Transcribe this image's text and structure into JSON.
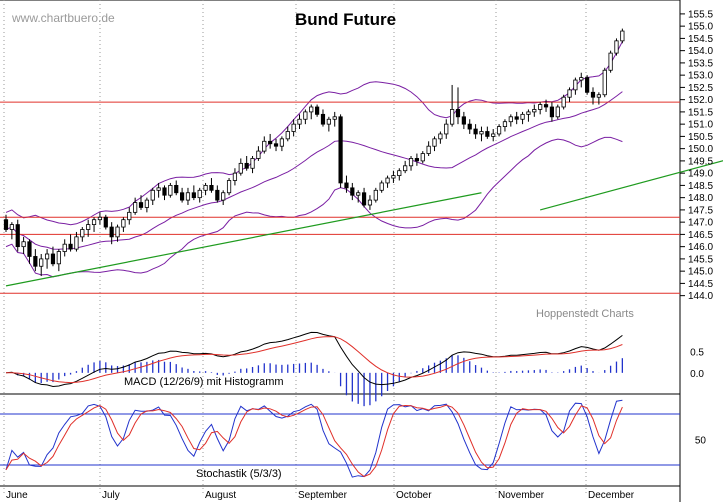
{
  "watermark": "www.chartbuero.de",
  "source_label": "Hoppenstedt Charts",
  "chart_data": [
    {
      "type": "candlestick",
      "title": "Bund Future",
      "y_ticks": [
        155.5,
        155.0,
        154.5,
        154.0,
        153.5,
        153.0,
        152.5,
        152.0,
        151.5,
        151.0,
        150.5,
        150.0,
        149.5,
        149.0,
        148.5,
        148.0,
        147.5,
        147.0,
        146.5,
        146.0,
        145.5,
        145.0,
        144.5,
        144.0
      ],
      "ylim": [
        143.7,
        155.7
      ],
      "x_labels": [
        "June",
        "July",
        "August",
        "September",
        "October",
        "November",
        "December"
      ],
      "horizontal_levels": [
        151.9,
        147.2,
        146.5,
        144.1
      ],
      "trendlines": [
        {
          "from": [
            0,
            144.4
          ],
          "to": [
            81,
            148.2
          ]
        },
        {
          "from": [
            91,
            147.5
          ],
          "to": [
            167,
            152.4
          ]
        }
      ],
      "candles": [
        [
          147.1,
          147.3,
          146.6,
          146.7
        ],
        [
          146.7,
          147.0,
          146.3,
          146.9
        ],
        [
          146.9,
          147.1,
          145.8,
          146.0
        ],
        [
          146.0,
          146.4,
          145.7,
          146.2
        ],
        [
          146.2,
          146.3,
          145.3,
          145.6
        ],
        [
          145.6,
          145.9,
          145.0,
          145.2
        ],
        [
          145.2,
          145.7,
          144.8,
          145.5
        ],
        [
          145.5,
          145.9,
          145.1,
          145.7
        ],
        [
          145.7,
          146.0,
          145.2,
          145.3
        ],
        [
          145.3,
          145.9,
          145.0,
          145.8
        ],
        [
          145.8,
          146.3,
          145.6,
          146.1
        ],
        [
          146.1,
          146.5,
          145.8,
          145.9
        ],
        [
          145.9,
          146.6,
          145.8,
          146.4
        ],
        [
          146.4,
          146.8,
          146.2,
          146.7
        ],
        [
          146.7,
          147.1,
          146.4,
          146.9
        ],
        [
          146.9,
          147.2,
          146.6,
          147.1
        ],
        [
          147.1,
          147.4,
          146.9,
          147.2
        ],
        [
          147.2,
          147.3,
          146.7,
          146.8
        ],
        [
          146.8,
          147.0,
          146.1,
          146.4
        ],
        [
          146.4,
          146.9,
          146.2,
          146.8
        ],
        [
          146.8,
          147.2,
          146.6,
          147.1
        ],
        [
          147.1,
          147.6,
          146.9,
          147.4
        ],
        [
          147.4,
          148.0,
          147.3,
          147.8
        ],
        [
          147.8,
          148.1,
          147.5,
          147.6
        ],
        [
          147.6,
          148.0,
          147.4,
          147.9
        ],
        [
          147.9,
          148.4,
          147.7,
          148.3
        ],
        [
          148.3,
          148.6,
          148.0,
          148.4
        ],
        [
          148.4,
          148.5,
          147.9,
          148.1
        ],
        [
          148.1,
          148.6,
          148.0,
          148.5
        ],
        [
          148.5,
          148.7,
          148.1,
          148.2
        ],
        [
          148.2,
          148.4,
          147.8,
          147.9
        ],
        [
          147.9,
          148.4,
          147.7,
          148.2
        ],
        [
          148.2,
          148.5,
          147.9,
          148.0
        ],
        [
          148.0,
          148.4,
          147.8,
          148.3
        ],
        [
          148.3,
          148.6,
          148.1,
          148.5
        ],
        [
          148.5,
          148.8,
          148.2,
          148.3
        ],
        [
          148.3,
          148.5,
          147.8,
          147.9
        ],
        [
          147.9,
          148.3,
          147.7,
          148.2
        ],
        [
          148.2,
          148.8,
          148.1,
          148.7
        ],
        [
          148.7,
          149.2,
          148.5,
          149.0
        ],
        [
          149.0,
          149.6,
          148.9,
          149.4
        ],
        [
          149.4,
          149.7,
          149.1,
          149.2
        ],
        [
          149.2,
          149.7,
          149.0,
          149.6
        ],
        [
          149.6,
          150.1,
          149.5,
          149.9
        ],
        [
          149.9,
          150.5,
          149.8,
          150.3
        ],
        [
          150.3,
          150.6,
          150.0,
          150.2
        ],
        [
          150.2,
          150.4,
          149.9,
          150.1
        ],
        [
          150.1,
          150.5,
          149.9,
          150.4
        ],
        [
          150.4,
          150.9,
          150.3,
          150.7
        ],
        [
          150.7,
          151.2,
          150.5,
          151.0
        ],
        [
          151.0,
          151.4,
          150.8,
          151.2
        ],
        [
          151.2,
          151.6,
          151.0,
          151.5
        ],
        [
          151.5,
          151.8,
          151.2,
          151.7
        ],
        [
          151.7,
          151.8,
          151.3,
          151.4
        ],
        [
          151.4,
          151.6,
          150.9,
          151.0
        ],
        [
          151.0,
          151.3,
          150.7,
          151.2
        ],
        [
          151.2,
          151.5,
          150.9,
          151.3
        ],
        [
          151.3,
          151.4,
          148.4,
          148.6
        ],
        [
          148.6,
          148.9,
          148.2,
          148.4
        ],
        [
          148.4,
          148.6,
          147.9,
          148.1
        ],
        [
          148.1,
          148.3,
          147.8,
          148.2
        ],
        [
          148.2,
          148.4,
          147.6,
          147.7
        ],
        [
          147.7,
          148.1,
          147.5,
          147.9
        ],
        [
          147.9,
          148.4,
          147.8,
          148.3
        ],
        [
          148.3,
          148.7,
          148.2,
          148.6
        ],
        [
          148.6,
          148.9,
          148.4,
          148.8
        ],
        [
          148.8,
          149.1,
          148.6,
          148.9
        ],
        [
          148.9,
          149.2,
          148.7,
          149.1
        ],
        [
          149.1,
          149.5,
          149.0,
          149.3
        ],
        [
          149.3,
          149.7,
          149.1,
          149.6
        ],
        [
          149.6,
          149.8,
          149.3,
          149.5
        ],
        [
          149.5,
          149.9,
          149.4,
          149.8
        ],
        [
          149.8,
          150.3,
          149.7,
          150.1
        ],
        [
          150.1,
          150.5,
          149.9,
          150.4
        ],
        [
          150.4,
          150.7,
          150.2,
          150.6
        ],
        [
          150.6,
          151.2,
          150.4,
          151.0
        ],
        [
          151.0,
          152.6,
          150.9,
          151.6
        ],
        [
          151.6,
          152.5,
          151.0,
          151.3
        ],
        [
          151.3,
          151.5,
          150.8,
          151.0
        ],
        [
          151.0,
          151.2,
          150.6,
          150.8
        ],
        [
          150.8,
          151.0,
          150.4,
          150.6
        ],
        [
          150.6,
          150.9,
          150.3,
          150.7
        ],
        [
          150.7,
          150.9,
          150.4,
          150.5
        ],
        [
          150.5,
          150.8,
          150.3,
          150.6
        ],
        [
          150.6,
          151.0,
          150.5,
          150.9
        ],
        [
          150.9,
          151.2,
          150.7,
          151.1
        ],
        [
          151.1,
          151.4,
          150.9,
          151.3
        ],
        [
          151.3,
          151.5,
          151.0,
          151.2
        ],
        [
          151.2,
          151.5,
          151.0,
          151.4
        ],
        [
          151.4,
          151.6,
          151.1,
          151.5
        ],
        [
          151.5,
          151.8,
          151.3,
          151.6
        ],
        [
          151.6,
          151.9,
          151.4,
          151.8
        ],
        [
          151.8,
          152.0,
          151.5,
          151.7
        ],
        [
          151.7,
          151.9,
          151.1,
          151.3
        ],
        [
          151.3,
          151.8,
          151.2,
          151.7
        ],
        [
          151.7,
          152.2,
          151.6,
          152.1
        ],
        [
          152.1,
          152.5,
          151.9,
          152.4
        ],
        [
          152.4,
          152.9,
          152.2,
          152.8
        ],
        [
          152.8,
          153.1,
          152.5,
          152.9
        ],
        [
          152.9,
          153.0,
          152.2,
          152.3
        ],
        [
          152.3,
          152.5,
          151.8,
          152.1
        ],
        [
          152.1,
          152.3,
          151.8,
          152.2
        ],
        [
          152.2,
          153.3,
          152.1,
          153.2
        ],
        [
          153.2,
          154.0,
          153.1,
          153.9
        ],
        [
          153.9,
          154.5,
          153.8,
          154.4
        ],
        [
          154.4,
          154.9,
          154.3,
          154.8
        ]
      ]
    },
    {
      "type": "line",
      "title": "MACD (12/26/9) mit Histogramm",
      "y_ticks": [
        0.5,
        0.0
      ],
      "ylim": [
        -0.45,
        1.1
      ]
    },
    {
      "type": "line",
      "title": "Stochastik (5/3/3)",
      "y_ticks": [
        50
      ],
      "reference_levels": [
        80,
        20
      ],
      "ylim": [
        0,
        100
      ]
    }
  ]
}
